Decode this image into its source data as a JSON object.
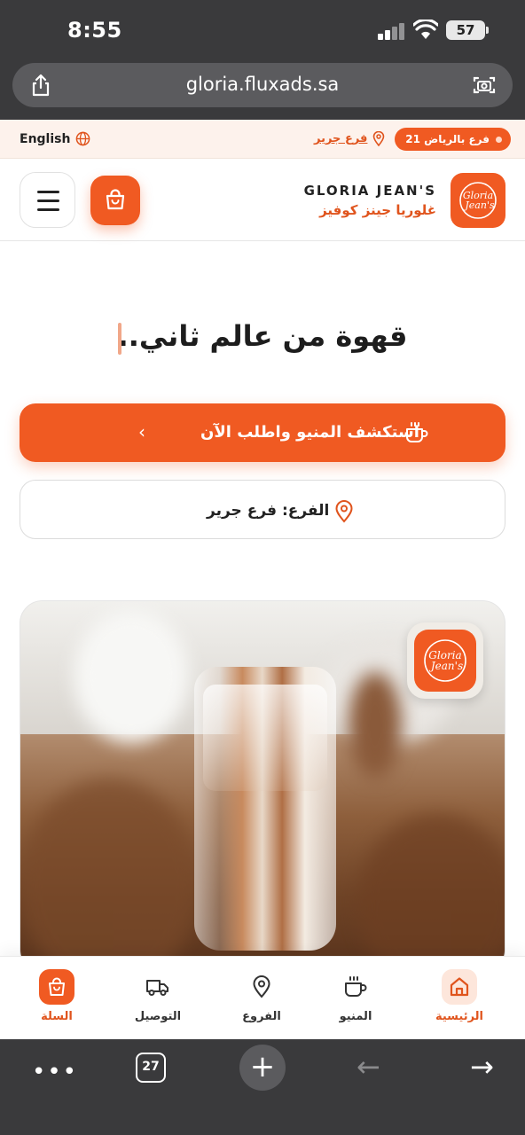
{
  "status_bar": {
    "time": "8:55",
    "battery": "57"
  },
  "browser": {
    "url": "gloria.fluxads.sa",
    "tabs_count": "27"
  },
  "top_strip": {
    "language": "English",
    "branches_pill": "21 فرع بالرياض",
    "current_branch_link": "فرع جرير"
  },
  "header": {
    "brand_en": "GLORIA JEAN'S",
    "brand_ar": "غلوريا جينز كوفيز",
    "logo_text_line1": "Gloria",
    "logo_text_line2": "Jean's"
  },
  "hero": {
    "headline": "قهوة من عالم ثاني..",
    "cta_label": "استكشف المنيو واطلب الآن",
    "branch_label": "الفرع: فرع جرير"
  },
  "bottom_nav": {
    "items": [
      {
        "label": "الرئيسية",
        "icon": "home-icon",
        "active": true
      },
      {
        "label": "المنيو",
        "icon": "coffee-cup-icon",
        "active": false
      },
      {
        "label": "الفروع",
        "icon": "location-pin-icon",
        "active": false
      },
      {
        "label": "التوصيل",
        "icon": "delivery-truck-icon",
        "active": false
      },
      {
        "label": "السلة",
        "icon": "shopping-bag-icon",
        "active": true
      }
    ]
  },
  "colors": {
    "accent": "#f05a22",
    "accent_text": "#e0541d",
    "strip_bg": "#fdf2ec",
    "chrome": "#3a3a3c"
  }
}
